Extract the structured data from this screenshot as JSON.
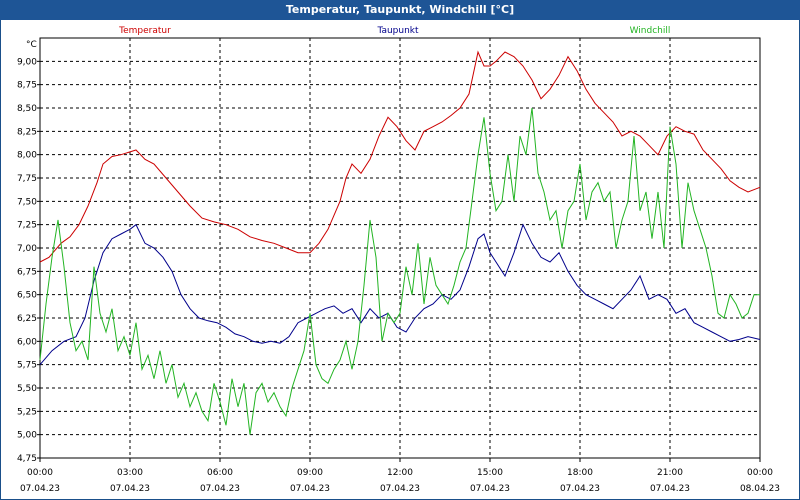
{
  "chart_data": {
    "type": "line",
    "title": "Temperatur, Taupunkt, Windchill [°C]",
    "yunit": "°C",
    "ylim": [
      4.75,
      9.25
    ],
    "yticks": [
      "4,75",
      "5,00",
      "5,25",
      "5,50",
      "5,75",
      "6,00",
      "6,25",
      "6,50",
      "6,75",
      "7,00",
      "7,25",
      "7,50",
      "7,75",
      "8,00",
      "8,25",
      "8,50",
      "8,75",
      "9,00"
    ],
    "xlim": [
      0,
      24
    ],
    "xticks": [
      {
        "time": "00:00",
        "date": "07.04.23"
      },
      {
        "time": "03:00",
        "date": "07.04.23"
      },
      {
        "time": "06:00",
        "date": "07.04.23"
      },
      {
        "time": "09:00",
        "date": "07.04.23"
      },
      {
        "time": "12:00",
        "date": "07.04.23"
      },
      {
        "time": "15:00",
        "date": "07.04.23"
      },
      {
        "time": "18:00",
        "date": "07.04.23"
      },
      {
        "time": "21:00",
        "date": "07.04.23"
      },
      {
        "time": "00:00",
        "date": "08.04.23"
      }
    ],
    "grid": true,
    "series": [
      {
        "name": "Temperatur",
        "color": "#cc0000",
        "points": [
          [
            0,
            6.85
          ],
          [
            0.3,
            6.9
          ],
          [
            0.7,
            7.05
          ],
          [
            1.0,
            7.12
          ],
          [
            1.3,
            7.25
          ],
          [
            1.6,
            7.45
          ],
          [
            1.9,
            7.7
          ],
          [
            2.1,
            7.9
          ],
          [
            2.4,
            7.98
          ],
          [
            2.7,
            8.0
          ],
          [
            3.0,
            8.03
          ],
          [
            3.2,
            8.05
          ],
          [
            3.5,
            7.95
          ],
          [
            3.8,
            7.9
          ],
          [
            4.2,
            7.75
          ],
          [
            4.6,
            7.6
          ],
          [
            5.0,
            7.45
          ],
          [
            5.4,
            7.32
          ],
          [
            5.8,
            7.28
          ],
          [
            6.2,
            7.25
          ],
          [
            6.6,
            7.2
          ],
          [
            7.0,
            7.12
          ],
          [
            7.4,
            7.08
          ],
          [
            7.8,
            7.05
          ],
          [
            8.2,
            7.0
          ],
          [
            8.6,
            6.95
          ],
          [
            9.0,
            6.95
          ],
          [
            9.3,
            7.05
          ],
          [
            9.6,
            7.2
          ],
          [
            10.0,
            7.5
          ],
          [
            10.2,
            7.75
          ],
          [
            10.4,
            7.9
          ],
          [
            10.7,
            7.8
          ],
          [
            11.0,
            7.95
          ],
          [
            11.3,
            8.2
          ],
          [
            11.6,
            8.4
          ],
          [
            11.9,
            8.3
          ],
          [
            12.2,
            8.15
          ],
          [
            12.5,
            8.05
          ],
          [
            12.8,
            8.25
          ],
          [
            13.1,
            8.3
          ],
          [
            13.4,
            8.35
          ],
          [
            13.7,
            8.42
          ],
          [
            14.0,
            8.5
          ],
          [
            14.3,
            8.65
          ],
          [
            14.6,
            9.1
          ],
          [
            14.8,
            8.95
          ],
          [
            15.0,
            8.95
          ],
          [
            15.2,
            9.0
          ],
          [
            15.5,
            9.1
          ],
          [
            15.8,
            9.05
          ],
          [
            16.1,
            8.95
          ],
          [
            16.4,
            8.8
          ],
          [
            16.7,
            8.6
          ],
          [
            17.0,
            8.7
          ],
          [
            17.3,
            8.85
          ],
          [
            17.6,
            9.05
          ],
          [
            17.9,
            8.9
          ],
          [
            18.2,
            8.7
          ],
          [
            18.5,
            8.55
          ],
          [
            18.8,
            8.45
          ],
          [
            19.1,
            8.35
          ],
          [
            19.4,
            8.2
          ],
          [
            19.7,
            8.25
          ],
          [
            20.0,
            8.2
          ],
          [
            20.3,
            8.1
          ],
          [
            20.6,
            8.0
          ],
          [
            20.9,
            8.2
          ],
          [
            21.2,
            8.3
          ],
          [
            21.5,
            8.25
          ],
          [
            21.8,
            8.22
          ],
          [
            22.1,
            8.05
          ],
          [
            22.4,
            7.95
          ],
          [
            22.7,
            7.85
          ],
          [
            23.0,
            7.72
          ],
          [
            23.3,
            7.65
          ],
          [
            23.6,
            7.6
          ],
          [
            24.0,
            7.65
          ]
        ]
      },
      {
        "name": "Taupunkt",
        "color": "#00008b",
        "points": [
          [
            0,
            5.75
          ],
          [
            0.4,
            5.9
          ],
          [
            0.8,
            6.0
          ],
          [
            1.2,
            6.05
          ],
          [
            1.5,
            6.25
          ],
          [
            1.8,
            6.65
          ],
          [
            2.1,
            6.95
          ],
          [
            2.4,
            7.1
          ],
          [
            2.7,
            7.15
          ],
          [
            3.0,
            7.2
          ],
          [
            3.2,
            7.25
          ],
          [
            3.5,
            7.05
          ],
          [
            3.8,
            7.0
          ],
          [
            4.1,
            6.9
          ],
          [
            4.4,
            6.75
          ],
          [
            4.7,
            6.5
          ],
          [
            5.0,
            6.35
          ],
          [
            5.3,
            6.25
          ],
          [
            5.6,
            6.22
          ],
          [
            5.9,
            6.2
          ],
          [
            6.2,
            6.15
          ],
          [
            6.5,
            6.08
          ],
          [
            6.8,
            6.05
          ],
          [
            7.1,
            6.0
          ],
          [
            7.4,
            5.98
          ],
          [
            7.7,
            6.0
          ],
          [
            8.0,
            5.98
          ],
          [
            8.3,
            6.05
          ],
          [
            8.6,
            6.2
          ],
          [
            8.9,
            6.25
          ],
          [
            9.2,
            6.3
          ],
          [
            9.5,
            6.35
          ],
          [
            9.8,
            6.38
          ],
          [
            10.1,
            6.3
          ],
          [
            10.4,
            6.35
          ],
          [
            10.7,
            6.2
          ],
          [
            11.0,
            6.35
          ],
          [
            11.3,
            6.25
          ],
          [
            11.6,
            6.3
          ],
          [
            11.9,
            6.15
          ],
          [
            12.2,
            6.1
          ],
          [
            12.5,
            6.25
          ],
          [
            12.8,
            6.35
          ],
          [
            13.1,
            6.4
          ],
          [
            13.4,
            6.5
          ],
          [
            13.7,
            6.45
          ],
          [
            14.0,
            6.55
          ],
          [
            14.3,
            6.8
          ],
          [
            14.6,
            7.1
          ],
          [
            14.8,
            7.15
          ],
          [
            15.0,
            6.95
          ],
          [
            15.2,
            6.85
          ],
          [
            15.5,
            6.7
          ],
          [
            15.8,
            6.95
          ],
          [
            16.1,
            7.25
          ],
          [
            16.4,
            7.05
          ],
          [
            16.7,
            6.9
          ],
          [
            17.0,
            6.85
          ],
          [
            17.3,
            6.95
          ],
          [
            17.6,
            6.75
          ],
          [
            17.9,
            6.6
          ],
          [
            18.2,
            6.5
          ],
          [
            18.5,
            6.45
          ],
          [
            18.8,
            6.4
          ],
          [
            19.1,
            6.35
          ],
          [
            19.4,
            6.45
          ],
          [
            19.7,
            6.55
          ],
          [
            20.0,
            6.7
          ],
          [
            20.3,
            6.45
          ],
          [
            20.6,
            6.5
          ],
          [
            20.9,
            6.45
          ],
          [
            21.2,
            6.3
          ],
          [
            21.5,
            6.35
          ],
          [
            21.8,
            6.2
          ],
          [
            22.1,
            6.15
          ],
          [
            22.4,
            6.1
          ],
          [
            22.7,
            6.05
          ],
          [
            23.0,
            6.0
          ],
          [
            23.3,
            6.02
          ],
          [
            23.6,
            6.05
          ],
          [
            24.0,
            6.02
          ]
        ]
      },
      {
        "name": "Windchill",
        "color": "#22b422",
        "points": [
          [
            0,
            5.8
          ],
          [
            0.2,
            6.4
          ],
          [
            0.4,
            6.9
          ],
          [
            0.6,
            7.3
          ],
          [
            0.8,
            6.8
          ],
          [
            1.0,
            6.2
          ],
          [
            1.2,
            5.9
          ],
          [
            1.4,
            6.0
          ],
          [
            1.6,
            5.8
          ],
          [
            1.8,
            6.8
          ],
          [
            2.0,
            6.3
          ],
          [
            2.2,
            6.1
          ],
          [
            2.4,
            6.35
          ],
          [
            2.6,
            5.9
          ],
          [
            2.8,
            6.05
          ],
          [
            3.0,
            5.85
          ],
          [
            3.2,
            6.2
          ],
          [
            3.4,
            5.7
          ],
          [
            3.6,
            5.85
          ],
          [
            3.8,
            5.6
          ],
          [
            4.0,
            5.9
          ],
          [
            4.2,
            5.55
          ],
          [
            4.4,
            5.75
          ],
          [
            4.6,
            5.4
          ],
          [
            4.8,
            5.55
          ],
          [
            5.0,
            5.3
          ],
          [
            5.2,
            5.45
          ],
          [
            5.4,
            5.25
          ],
          [
            5.6,
            5.15
          ],
          [
            5.8,
            5.55
          ],
          [
            6.0,
            5.35
          ],
          [
            6.2,
            5.1
          ],
          [
            6.4,
            5.6
          ],
          [
            6.6,
            5.3
          ],
          [
            6.8,
            5.55
          ],
          [
            7.0,
            5.0
          ],
          [
            7.2,
            5.45
          ],
          [
            7.4,
            5.55
          ],
          [
            7.6,
            5.35
          ],
          [
            7.8,
            5.45
          ],
          [
            8.0,
            5.3
          ],
          [
            8.2,
            5.2
          ],
          [
            8.4,
            5.5
          ],
          [
            8.6,
            5.7
          ],
          [
            8.8,
            5.9
          ],
          [
            9.0,
            6.3
          ],
          [
            9.2,
            5.75
          ],
          [
            9.4,
            5.6
          ],
          [
            9.6,
            5.55
          ],
          [
            9.8,
            5.7
          ],
          [
            10.0,
            5.8
          ],
          [
            10.2,
            6.0
          ],
          [
            10.4,
            5.7
          ],
          [
            10.6,
            6.0
          ],
          [
            10.8,
            6.6
          ],
          [
            11.0,
            7.3
          ],
          [
            11.2,
            6.9
          ],
          [
            11.4,
            6.0
          ],
          [
            11.6,
            6.3
          ],
          [
            11.8,
            6.2
          ],
          [
            12.0,
            6.3
          ],
          [
            12.2,
            6.8
          ],
          [
            12.4,
            6.5
          ],
          [
            12.6,
            7.05
          ],
          [
            12.8,
            6.4
          ],
          [
            13.0,
            6.9
          ],
          [
            13.2,
            6.6
          ],
          [
            13.4,
            6.5
          ],
          [
            13.6,
            6.4
          ],
          [
            13.8,
            6.6
          ],
          [
            14.0,
            6.85
          ],
          [
            14.2,
            7.0
          ],
          [
            14.4,
            7.5
          ],
          [
            14.6,
            8.0
          ],
          [
            14.8,
            8.4
          ],
          [
            15.0,
            7.8
          ],
          [
            15.2,
            7.4
          ],
          [
            15.4,
            7.5
          ],
          [
            15.6,
            8.0
          ],
          [
            15.8,
            7.5
          ],
          [
            16.0,
            8.2
          ],
          [
            16.2,
            8.0
          ],
          [
            16.4,
            8.5
          ],
          [
            16.6,
            7.8
          ],
          [
            16.8,
            7.6
          ],
          [
            17.0,
            7.3
          ],
          [
            17.2,
            7.4
          ],
          [
            17.4,
            7.0
          ],
          [
            17.6,
            7.4
          ],
          [
            17.8,
            7.5
          ],
          [
            18.0,
            7.9
          ],
          [
            18.2,
            7.3
          ],
          [
            18.4,
            7.6
          ],
          [
            18.6,
            7.7
          ],
          [
            18.8,
            7.5
          ],
          [
            19.0,
            7.6
          ],
          [
            19.2,
            7.0
          ],
          [
            19.4,
            7.3
          ],
          [
            19.6,
            7.5
          ],
          [
            19.8,
            8.2
          ],
          [
            20.0,
            7.4
          ],
          [
            20.2,
            7.6
          ],
          [
            20.4,
            7.1
          ],
          [
            20.6,
            7.6
          ],
          [
            20.8,
            7.0
          ],
          [
            21.0,
            8.3
          ],
          [
            21.2,
            7.9
          ],
          [
            21.4,
            7.0
          ],
          [
            21.6,
            7.7
          ],
          [
            21.8,
            7.4
          ],
          [
            22.0,
            7.2
          ],
          [
            22.2,
            7.0
          ],
          [
            22.4,
            6.7
          ],
          [
            22.6,
            6.3
          ],
          [
            22.8,
            6.25
          ],
          [
            23.0,
            6.5
          ],
          [
            23.2,
            6.4
          ],
          [
            23.4,
            6.25
          ],
          [
            23.6,
            6.3
          ],
          [
            23.8,
            6.5
          ],
          [
            24.0,
            6.5
          ]
        ]
      }
    ]
  }
}
